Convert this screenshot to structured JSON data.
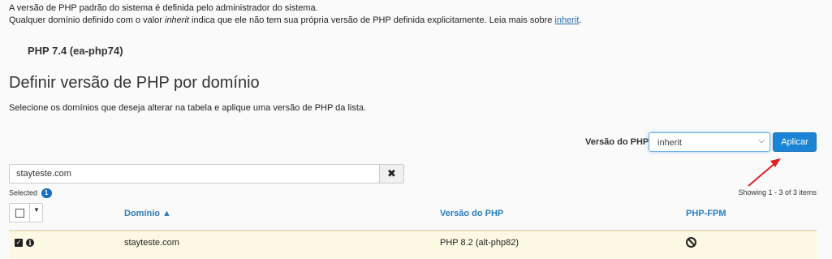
{
  "intro": {
    "line1": "A versão de PHP padrão do sistema é definida pelo administrador do sistema.",
    "line2_a": "Qualquer domínio definido com o valor ",
    "line2_em": "inherit",
    "line2_b": " indica que ele não tem sua própria versão de PHP definida explicitamente. Leia mais sobre ",
    "link": "inherit",
    "line2_end": "."
  },
  "default_version": "PHP 7.4 (ea-php74)",
  "section_title": "Definir versão de PHP por domínio",
  "section_desc": "Selecione os domínios que deseja alterar na tabela e aplique uma versão de PHP da lista.",
  "version_picker": {
    "label": "Versão do PHP",
    "selected": "inherit",
    "apply_label": "Aplicar"
  },
  "search": {
    "value": "stayteste.com",
    "clear_icon": "✖"
  },
  "selection": {
    "label": "Selected",
    "count": "1"
  },
  "showing": {
    "prefix": "Showing ",
    "range": "1 - 3",
    "suffix": " of 3 items"
  },
  "table": {
    "columns": {
      "domain": "Domínio ▲",
      "php_version": "Versão do PHP",
      "php_fpm": "PHP-FPM"
    },
    "rows": [
      {
        "domain": "stayteste.com",
        "php_version": "PHP 8.2 (alt-php82)",
        "php_fpm_icon": "disabled-icon"
      }
    ]
  },
  "colors": {
    "accent": "#1a84d6",
    "link": "#2a7ec2",
    "selected_row": "#fcf8e3",
    "annotation_arrow": "#e02020"
  }
}
